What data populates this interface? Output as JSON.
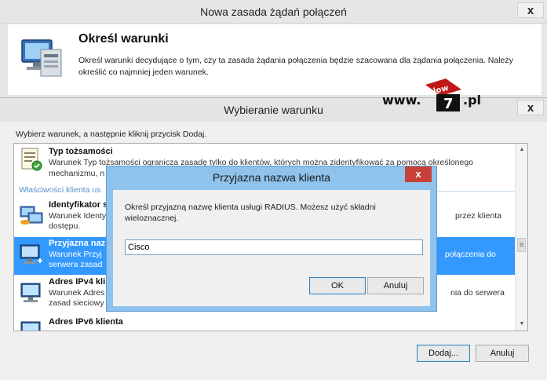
{
  "back_window": {
    "title": "Nowa zasada żądań połączeń",
    "close": "x",
    "header_title": "Określ warunki",
    "header_desc": "Określ warunki decydujące o tym, czy ta zasada żądania połączenia będzie szacowana dla żądania połączenia. Należy określić co najmniej jeden warunek.",
    "header_icon": "monitor-settings-icon"
  },
  "watermark": {
    "prefix": "www.",
    "logo_text": "slow",
    "logo_number": "7",
    "suffix": ".pl"
  },
  "condition_window": {
    "title": "Wybieranie warunku",
    "close": "x",
    "instruction": "Wybierz warunek, a następnie kliknij przycisk Dodaj.",
    "list": {
      "items": [
        {
          "title": "Typ tożsamości",
          "desc": "Warunek Typ tożsamości ogranicza zasadę tylko do klientów, których można zidentyfikować za pomocą określonego mechanizmu, n",
          "icon": "certificate-icon"
        },
        {
          "title": "Identyfikator s",
          "desc": "Warunek Identy",
          "desc2": "dostępu.",
          "right": "przez klienta",
          "icon": "network-clients-icon"
        },
        {
          "title": "Przyjazna naz",
          "desc": "Warunek Przyj",
          "desc2": "serwera zasad",
          "right": "połączenia do",
          "icon": "monitor-network-icon",
          "selected": true
        },
        {
          "title": "Adres IPv4 kli",
          "desc": "Warunek Adres",
          "desc2": "zasad sieciowy",
          "right": "nia do serwera",
          "icon": "computer-icon"
        },
        {
          "title": "Adres IPv6 klienta",
          "icon": "computer-icon"
        }
      ],
      "group_header": "Właściwości klienta us"
    },
    "buttons": {
      "add": "Dodaj...",
      "cancel": "Anuluj"
    }
  },
  "dialog": {
    "title": "Przyjazna nazwa klienta",
    "close": "x",
    "text": "Określ przyjazną nazwę klienta usługi RADIUS. Możesz użyć składni wieloznacznej.",
    "input_value": "Cisco",
    "ok": "OK",
    "cancel": "Anuluj"
  }
}
